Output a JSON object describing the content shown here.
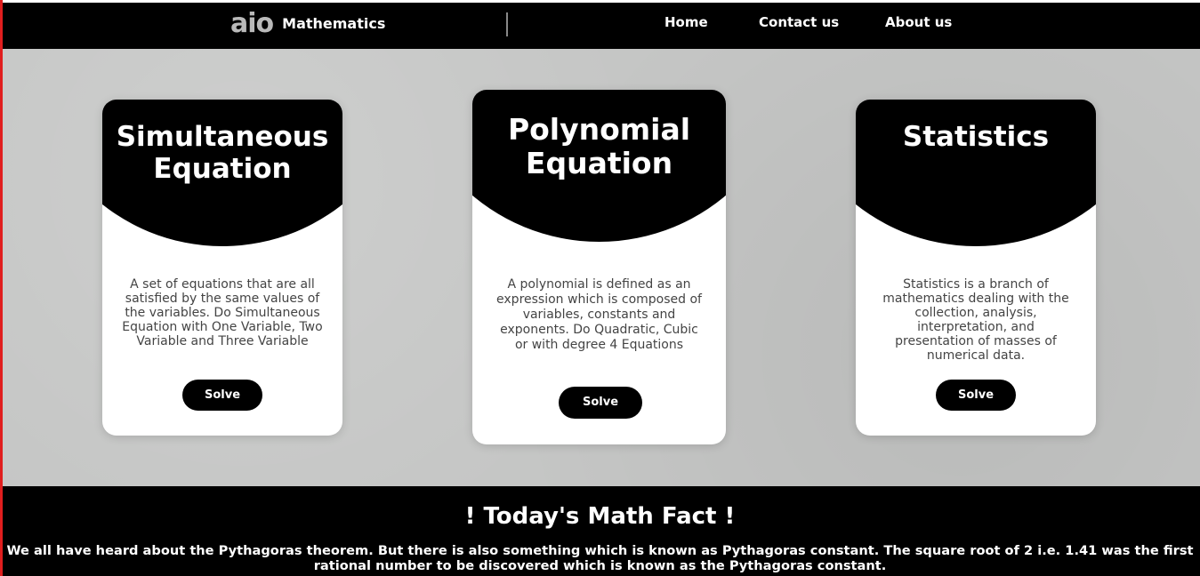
{
  "header": {
    "logo_mark": "aio",
    "logo_text": "Mathematics",
    "nav": [
      "Home",
      "Contact us",
      "About us"
    ]
  },
  "cards": [
    {
      "title_line1": "Simultaneous",
      "title_line2": "Equation",
      "description": "A set of equations that are all satisfied by the same values of the variables. Do Simultaneous Equation with One Variable, Two Variable and Three Variable",
      "button": "Solve"
    },
    {
      "title_line1": "Polynomial",
      "title_line2": "Equation",
      "description": "A polynomial is defined as an expression which is composed of variables, constants and exponents. Do Quadratic, Cubic or with degree 4 Equations",
      "button": "Solve"
    },
    {
      "title_line1": "Statistics",
      "title_line2": "",
      "description": "Statistics is a branch of mathematics dealing with the collection, analysis, interpretation, and presentation of masses of numerical data.",
      "button": "Solve"
    }
  ],
  "fact": {
    "title": "! Today's Math Fact !",
    "text": "We all have heard about the Pythagoras theorem. But there is also something which is known as Pythagoras constant. The square root of 2 i.e. 1.41 was the first rational number to be discovered which is known as the Pythagoras constant."
  }
}
